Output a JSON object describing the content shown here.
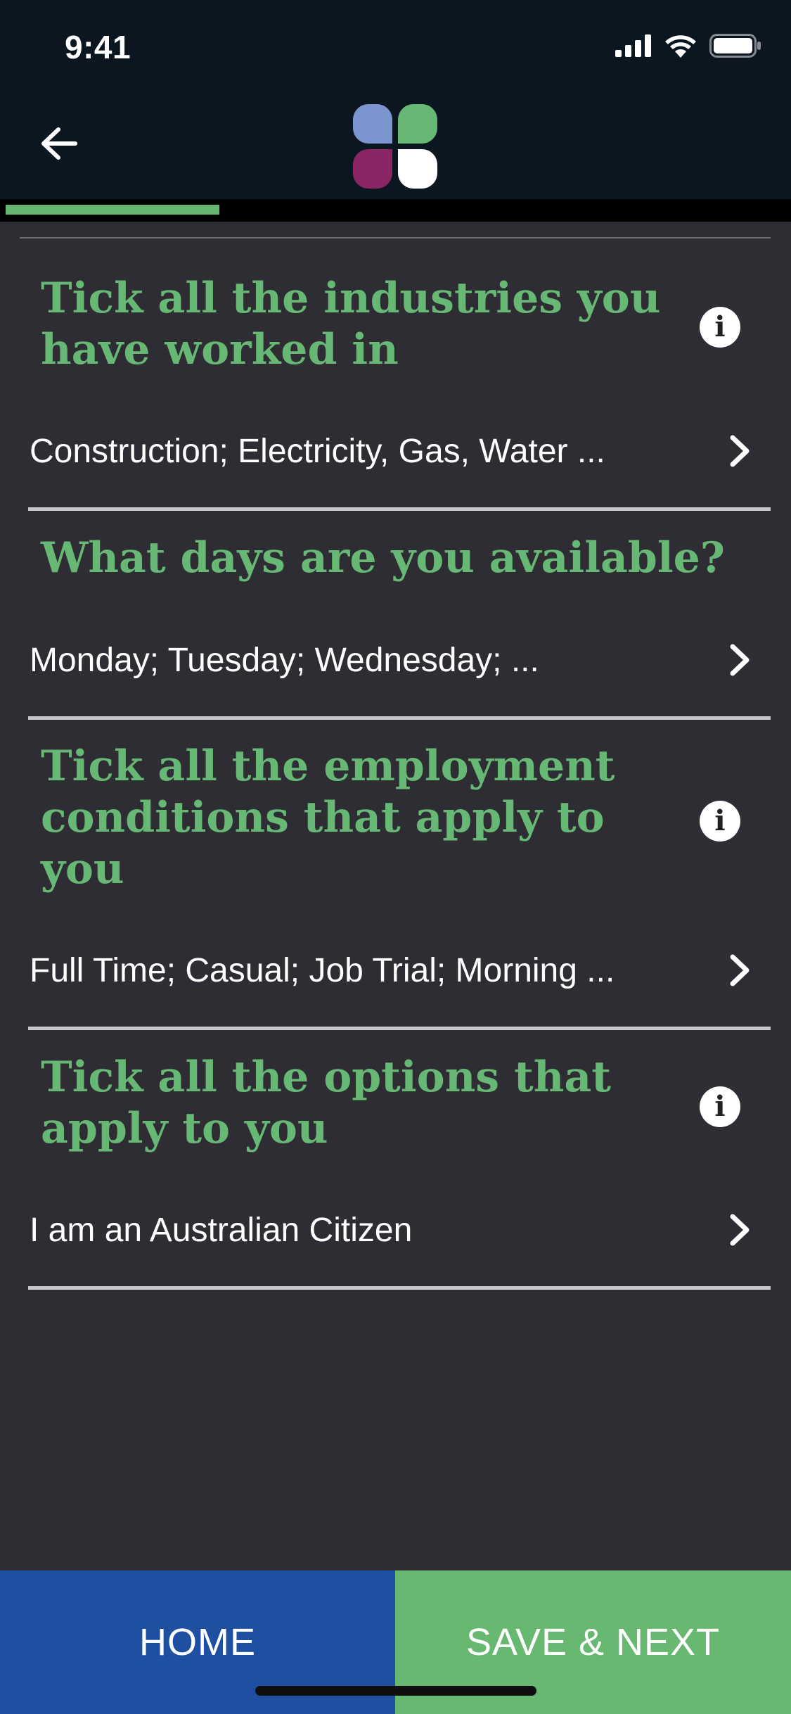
{
  "status_bar": {
    "time": "9:41"
  },
  "header": {
    "back_icon": "arrow-left-icon",
    "logo_icon": "four-petal-logo",
    "logo_colors": [
      "#7b95cf",
      "#67b874",
      "#8a2566",
      "#ffffff"
    ]
  },
  "progress": {
    "fraction": 0.27,
    "color": "#66b66f"
  },
  "questions": [
    {
      "title_line1": "Tick all the industries you",
      "title_line2": "have worked in",
      "title_line3": "",
      "has_info": true,
      "answer": "Construction; Electricity, Gas, Water ..."
    },
    {
      "title_line1": "What days are you available?",
      "title_line2": "",
      "title_line3": "",
      "has_info": false,
      "answer": "Monday; Tuesday; Wednesday; ..."
    },
    {
      "title_line1": "Tick all the employment",
      "title_line2": "conditions that apply to",
      "title_line3": "you",
      "has_info": true,
      "answer": "Full Time; Casual; Job Trial; Morning ..."
    },
    {
      "title_line1": "Tick all the options that",
      "title_line2": "apply to you",
      "title_line3": "",
      "has_info": true,
      "answer": "I am an Australian Citizen"
    }
  ],
  "info_icon_label": "i",
  "footer": {
    "home_label": "HOME",
    "save_label": "SAVE & NEXT",
    "home_color": "#1f4fa1",
    "save_color": "#67b870"
  },
  "colors": {
    "background": "#2e2d33",
    "header": "#0b1620",
    "title_green": "#67b874"
  }
}
